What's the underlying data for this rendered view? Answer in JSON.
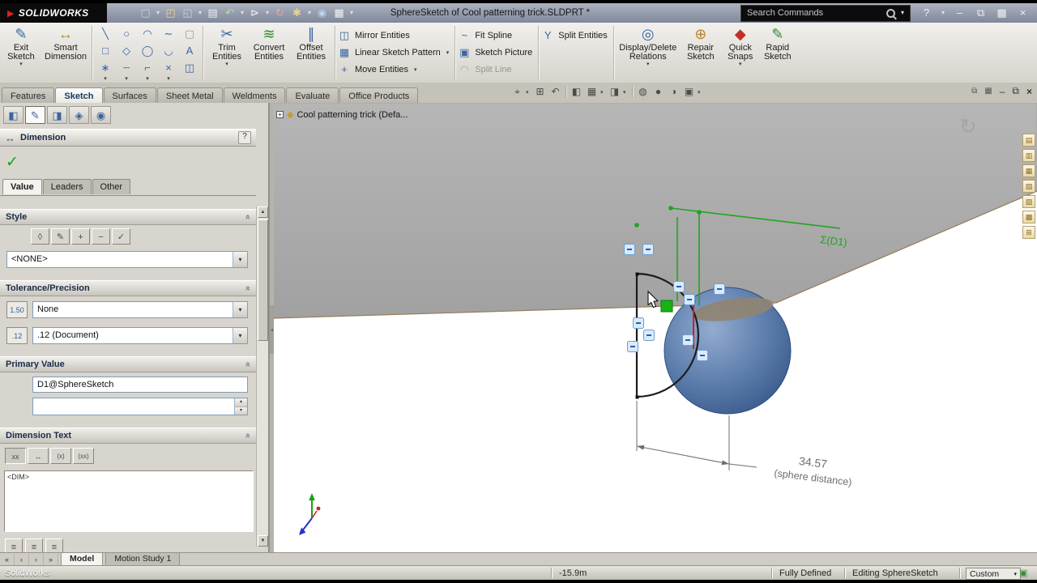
{
  "titlebar": {
    "logo": "SOLIDWORKS",
    "title": "SphereSketch of Cool patterning trick.SLDPRT *",
    "search_placeholder": "Search Commands"
  },
  "icons": {
    "brand_arrow": "▶",
    "new_doc": "▢",
    "open_doc": "◰",
    "save_doc": "◱",
    "print_doc": "▤",
    "undo": "↶",
    "select": "⊳",
    "rebuild": "↻",
    "options": "✱",
    "appearance": "◉",
    "view_grid": "▦",
    "dropdown": "▾",
    "help": "?",
    "minimize": "–",
    "restore": "⧉",
    "grid_win": "▦",
    "close": "×",
    "exit_sketch": "✎",
    "smart_dimension": "↔",
    "trim": "✂",
    "convert": "≋",
    "offset": "∥",
    "mirror": "◫",
    "linear_pattern": "▦",
    "move": "+",
    "fit_spline": "~",
    "sketch_picture": "▣",
    "split_line": "◠",
    "split_entities": "Y",
    "display_delete": "◎",
    "repair": "⊕",
    "quick_snaps": "◆",
    "rapid_sketch": "✎",
    "check": "✓",
    "section_collapse": "»",
    "spin_up": "▴",
    "spin_down": "▾",
    "scroll_up": "▲",
    "scroll_down": "▼",
    "splitter_arrow": "◂",
    "expand_plus": "+",
    "part": "◆",
    "dimension": "↔",
    "rotate_ghost": "↻",
    "close_ghost": "×",
    "config_status": "▣",
    "tolerance_box": "1.50",
    "precision_box": ".12"
  },
  "ribbon": {
    "exit_sketch": "Exit\nSketch",
    "smart_dimension": "Smart\nDimension",
    "trim_entities": "Trim\nEntities",
    "convert_entities": "Convert\nEntities",
    "offset_entities": "Offset\nEntities",
    "mirror_entities": "Mirror Entities",
    "linear_sketch_pattern": "Linear Sketch Pattern",
    "move_entities": "Move Entities",
    "fit_spline": "Fit Spline",
    "sketch_picture": "Sketch Picture",
    "split_line": "Split Line",
    "split_entities": "Split Entities",
    "display_delete_relations": "Display/Delete\nRelations",
    "repair_sketch": "Repair\nSketch",
    "quick_snaps": "Quick\nSnaps",
    "rapid_sketch": "Rapid\nSketch"
  },
  "command_tabs": [
    {
      "label": "Features"
    },
    {
      "label": "Sketch"
    },
    {
      "label": "Surfaces"
    },
    {
      "label": "Sheet Metal"
    },
    {
      "label": "Weldments"
    },
    {
      "label": "Evaluate"
    },
    {
      "label": "Office Products"
    }
  ],
  "headsup": [
    {
      "glyph": "⌖"
    },
    {
      "glyph": "⊞"
    },
    {
      "glyph": "↶"
    },
    {
      "glyph": "◧"
    },
    {
      "glyph": "▦"
    },
    {
      "glyph": "◨"
    },
    {
      "glyph": "◍"
    },
    {
      "glyph": "●"
    },
    {
      "glyph": "◑"
    },
    {
      "glyph": "▣"
    }
  ],
  "right_tools": [
    {
      "glyph": "▤"
    },
    {
      "glyph": "▥"
    },
    {
      "glyph": "▦"
    },
    {
      "glyph": "▧"
    },
    {
      "glyph": "▨"
    },
    {
      "glyph": "▩"
    },
    {
      "glyph": "⊞"
    }
  ],
  "pm_tabs": [
    {
      "glyph": "◧"
    },
    {
      "glyph": "✎"
    },
    {
      "glyph": "◨"
    },
    {
      "glyph": "◈"
    },
    {
      "glyph": "◉"
    }
  ],
  "sketch_tools": [
    {
      "glyph": "╲"
    },
    {
      "glyph": "○"
    },
    {
      "glyph": "◠"
    },
    {
      "glyph": "∼"
    },
    {
      "glyph": "▢"
    },
    {
      "glyph": "□"
    },
    {
      "glyph": "◇"
    },
    {
      "glyph": "◯"
    },
    {
      "glyph": "◡"
    },
    {
      "glyph": "A"
    },
    {
      "glyph": "∗"
    },
    {
      "glyph": "┄"
    },
    {
      "glyph": "⌐"
    },
    {
      "glyph": "×"
    },
    {
      "glyph": "◫"
    }
  ],
  "style_tools": [
    {
      "glyph": "◊"
    },
    {
      "glyph": "✎"
    },
    {
      "glyph": "+"
    },
    {
      "glyph": "−"
    },
    {
      "glyph": "✓"
    }
  ],
  "dimtext_tools": [
    {
      "glyph": "xx"
    },
    {
      "glyph": "↔"
    },
    {
      "glyph": "(x)"
    },
    {
      "glyph": "(xx)"
    }
  ],
  "align_tools": [
    {
      "glyph": "≡"
    },
    {
      "glyph": "≡"
    },
    {
      "glyph": "≡"
    }
  ],
  "doc_nav": [
    {
      "glyph": "«"
    },
    {
      "glyph": "‹"
    },
    {
      "glyph": "›"
    },
    {
      "glyph": "»"
    }
  ],
  "property_panel": {
    "title": "Dimension",
    "help": "?",
    "tabs": [
      {
        "label": "Value"
      },
      {
        "label": "Leaders"
      },
      {
        "label": "Other"
      }
    ],
    "sections": {
      "style": {
        "title": "Style",
        "dropdown_value": "<NONE>"
      },
      "tolerance": {
        "title": "Tolerance/Precision",
        "tolerance_value": "None",
        "precision_value": ".12 (Document)"
      },
      "primary_value": {
        "title": "Primary Value",
        "dimension_name": "D1@SphereSketch",
        "dimension_value": ""
      },
      "dimension_text": {
        "title": "Dimension Text",
        "text_value": "<DIM>"
      }
    }
  },
  "viewport": {
    "feature_tree_root": "Cool patterning trick  (Defa...",
    "sigma_label": "Σ(D1)",
    "dim_value": "34.57",
    "dim_note": "(sphere distance)"
  },
  "doc_tabs": [
    {
      "label": "Model"
    },
    {
      "label": "Motion Study 1"
    }
  ],
  "statusbar": {
    "app_name": "SolidWorks",
    "measurement": "-15.9m",
    "sketch_state": "Fully Defined",
    "editing": "Editing SphereSketch",
    "config": "Custom"
  },
  "colors": {
    "brand_red": "#d9261c",
    "plane_fill": "#ababab",
    "plane_edge": "#98805c",
    "sphere_light": "#93acd0",
    "sphere_mid": "#5f7fae",
    "sphere_dark": "#3a5a8c",
    "sketch_black": "#1c1c1c",
    "sketch_green": "#1fa51f",
    "sketch_red": "#cc2020",
    "dim_gray": "#6e6e6e",
    "relation_fill": "#d9eafc",
    "relation_border": "#6f9fd0"
  }
}
